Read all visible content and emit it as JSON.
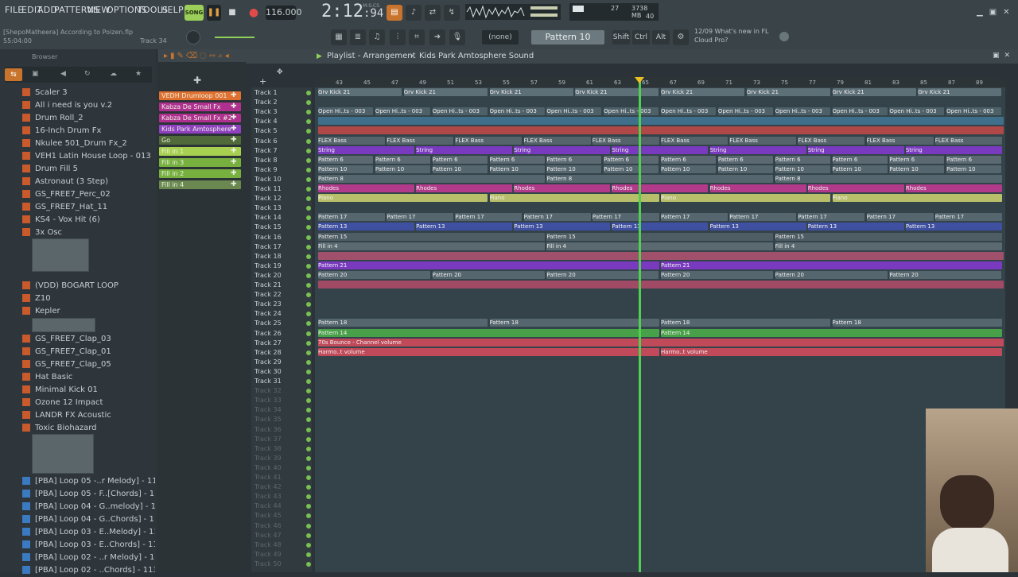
{
  "menu": [
    "FILE",
    "EDIT",
    "ADD",
    "PATTERNS",
    "VIEW",
    "OPTIONS",
    "TOOLS",
    "HELP"
  ],
  "transport": {
    "mode": "SONG",
    "tempo": "116.000",
    "time": "2:12",
    "time_small": ":94",
    "time_unit": "M:S:CS"
  },
  "cpu": {
    "poly": "27",
    "mem": "3738 MB",
    "cores": "40"
  },
  "hint": {
    "line1": "[ShepoMatheera] According to Poizen.flp",
    "line2": "55:04:00",
    "track": "Track 34"
  },
  "toolbar": {
    "none": "(none)",
    "pattern": "Pattern 10",
    "keys": [
      "Shift",
      "Ctrl",
      "Alt"
    ]
  },
  "news": {
    "date": "12/09",
    "line1": "What's new in FL",
    "line2": "Cloud Pro?"
  },
  "playlist": {
    "title": "Playlist - Arrangement",
    "pattern_name": "Kids Park Amtosphere Sound"
  },
  "browser": {
    "label": "Browser",
    "items": [
      "Scaler 3",
      "All i need is you v.2",
      "Drum Roll_2",
      "16-Inch Drum Fx",
      "Nkulee 501_Drum Fx_2",
      "VEH1 Latin House Loop - 013",
      "Drum Fill 5",
      "Astronaut (3 Step)",
      "GS_FREE7_Perc_02",
      "GS_FREE7_Hat_11",
      "KS4 - Vox Hit (6)",
      "3x Osc",
      "(VDD) BOGART LOOP",
      "Z10",
      "Kepler",
      "GS_FREE7_Clap_03",
      "GS_FREE7_Clap_01",
      "GS_FREE7_Clap_05",
      "Hat Basic",
      "Minimal Kick 01",
      "Ozone 12 Impact",
      "LANDR FX Acoustic",
      "Toxic Biohazard",
      "[PBA] Loop 05 -..r Melody] - 113bpms",
      "[PBA] Loop 05 - F..[Chords] - 113bpms",
      "[PBA] Loop 04 - G..melody] - 113bpms",
      "[PBA] Loop 04 - G..Chords] - 113bpms",
      "[PBA] Loop 03 - E..Melody] - 113bpms",
      "[PBA] Loop 03 - E..Chords] - 113bpms",
      "[PBA] Loop 02 - ..r Melody] - 113bpms",
      "[PBA] Loop 02 - ..Chords] - 113bpms"
    ]
  },
  "channels": [
    {
      "label": "VEDH Drumloop 001",
      "color": "#e07030"
    },
    {
      "label": "Kabza De Small Fx",
      "color": "#b03090"
    },
    {
      "label": "Kabza De Small Fx #2",
      "color": "#b03090"
    },
    {
      "label": "Kids Park Amtosphere",
      "color": "#9040c0"
    },
    {
      "label": "Go",
      "color": "#506a3a"
    },
    {
      "label": "Fill in 1",
      "color": "#a8d050"
    },
    {
      "label": "Fill in 3",
      "color": "#78b040"
    },
    {
      "label": "Fill in 2",
      "color": "#78b040"
    },
    {
      "label": "Fill in 4",
      "color": "#6a8850"
    }
  ],
  "ruler": [
    "43",
    "45",
    "47",
    "49",
    "51",
    "53",
    "55",
    "57",
    "59",
    "61",
    "63",
    "65",
    "67",
    "69",
    "71",
    "73",
    "75",
    "77",
    "79",
    "81",
    "83",
    "85",
    "87",
    "89"
  ],
  "tracks": [
    "Track 1",
    "Track 2",
    "Track 3",
    "Track 4",
    "Track 5",
    "Track 6",
    "Track 7",
    "Track 8",
    "Track 9",
    "Track 10",
    "Track 11",
    "Track 12",
    "Track 13",
    "Track 14",
    "Track 15",
    "Track 16",
    "Track 17",
    "Track 18",
    "Track 19",
    "Track 20",
    "Track 21",
    "Track 22",
    "Track 23",
    "Track 24",
    "Track 25",
    "Track 26",
    "Track 27",
    "Track 28",
    "Track 29",
    "Track 30",
    "Track 31",
    "Track 32",
    "Track 33",
    "Track 34",
    "Track 35",
    "Track 36",
    "Track 37",
    "Track 38",
    "Track 39",
    "Track 40",
    "Track 41",
    "Track 42",
    "Track 43",
    "Track 44",
    "Track 45",
    "Track 46",
    "Track 47",
    "Track 48",
    "Track 49",
    "Track 50"
  ],
  "clip_rows": [
    {
      "track": 1,
      "label": "Grv Kick 21",
      "color": "#5d6f77",
      "repeat": 8
    },
    {
      "track": 3,
      "label": "Open Hi..ts - 003",
      "color": "#4e6068",
      "repeat": 12
    },
    {
      "track": 4,
      "label": "",
      "color": "#3f6f8a",
      "repeat": 1
    },
    {
      "track": 5,
      "label": "",
      "color": "#b04848",
      "repeat": 1
    },
    {
      "track": 6,
      "label": "FLEX Bass",
      "color": "#55636a",
      "repeat": 10
    },
    {
      "track": 7,
      "label": "String",
      "color": "#7a3ac0",
      "repeat": 7
    },
    {
      "track": 8,
      "label": "Pattern 6",
      "color": "#5b6a72",
      "repeat": 12
    },
    {
      "track": 9,
      "label": "Pattern 10",
      "color": "#55666e",
      "repeat": 12
    },
    {
      "track": 10,
      "label": "Pattern 8",
      "color": "#55666e",
      "repeat": 3
    },
    {
      "track": 11,
      "label": "Rhodes",
      "color": "#b23a8a",
      "repeat": 7
    },
    {
      "track": 12,
      "label": "Piano",
      "color": "#b8bf6a",
      "repeat": 4
    },
    {
      "track": 14,
      "label": "Pattern 17",
      "color": "#55666e",
      "repeat": 10
    },
    {
      "track": 15,
      "label": "Pattern 13",
      "color": "#4050a0",
      "repeat": 7
    },
    {
      "track": 16,
      "label": "Pattern 15",
      "color": "#4e5c63",
      "repeat": 3
    },
    {
      "track": 17,
      "label": "Fill in 4",
      "color": "#5a6a70",
      "repeat": 3
    },
    {
      "track": 18,
      "label": "",
      "color": "#a0506a",
      "repeat": 1
    },
    {
      "track": 19,
      "label": "Pattern 21",
      "color": "#7a3ac0",
      "repeat": 2
    },
    {
      "track": 20,
      "label": "Pattern 20",
      "color": "#55666e",
      "repeat": 6
    },
    {
      "track": 21,
      "label": "",
      "color": "#a04a66",
      "repeat": 1
    },
    {
      "track": 25,
      "label": "Pattern 18",
      "color": "#55666e",
      "repeat": 4
    },
    {
      "track": 26,
      "label": "Pattern 14",
      "color": "#48a048",
      "repeat": 2
    },
    {
      "track": 27,
      "label": "70s Bounce - Channel volume",
      "color": "#c04a5a",
      "repeat": 1
    },
    {
      "track": 28,
      "label": "Harmo..t volume",
      "color": "#c04a5a",
      "repeat": 2
    }
  ]
}
